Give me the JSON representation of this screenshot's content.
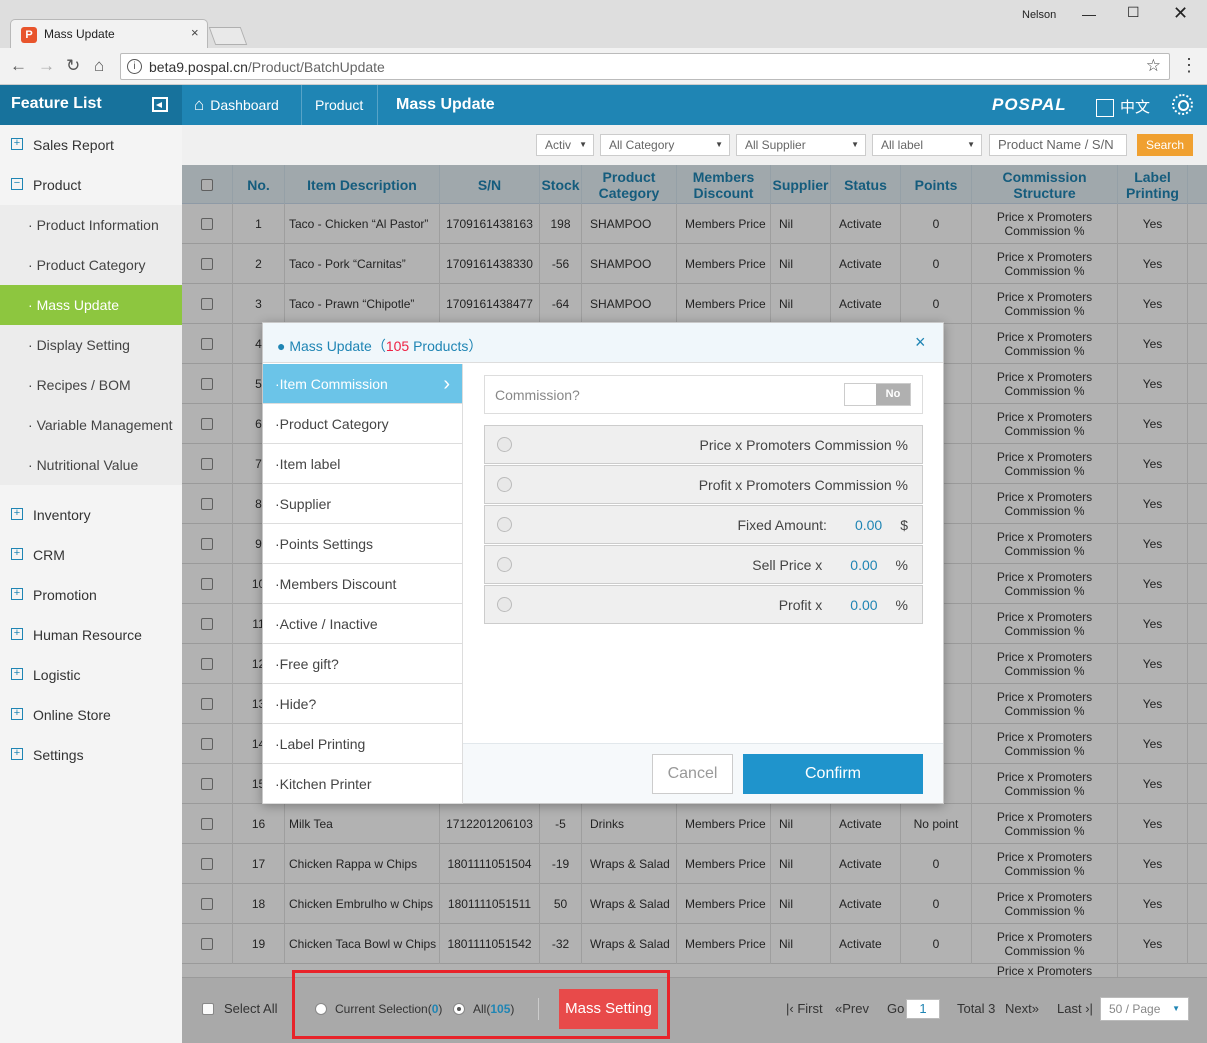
{
  "browser": {
    "tab_title": "Mass Update",
    "tab_close": "×",
    "user": "Nelson",
    "url_host": "beta9.pospal.cn",
    "url_path": "/Product/BatchUpdate"
  },
  "header": {
    "feature_list": "Feature List",
    "breadcrumb": [
      "Dashboard",
      "Product",
      "Mass Update"
    ],
    "logo": "POSPAL",
    "lang": "中文"
  },
  "sidebar": {
    "items": [
      {
        "label": "Sales Report",
        "sign": "+"
      },
      {
        "label": "Product",
        "sign": "−"
      }
    ],
    "subitems": [
      "Product Information",
      "Product Category",
      "Mass Update",
      "Display Setting",
      "Recipes / BOM",
      "Variable Management",
      "Nutritional Value"
    ],
    "active_sub": "Mass Update",
    "more_items": [
      "Inventory",
      "CRM",
      "Promotion",
      "Human Resource",
      "Logistic",
      "Online Store",
      "Settings"
    ]
  },
  "filters": {
    "status": "Activ",
    "category": "All Category",
    "supplier": "All Supplier",
    "label": "All label",
    "search_placeholder": "Product Name / S/N",
    "search_btn": "Search"
  },
  "table": {
    "headers": [
      "No.",
      "Item Description",
      "S/N",
      "Stock",
      "Product Category",
      "Members Discount",
      "Supplier",
      "Status",
      "Points",
      "Commission Structure",
      "Label Printing"
    ],
    "rows": [
      {
        "no": "1",
        "desc": "Taco - Chicken “Al Pastor”",
        "sn": "1709161438163",
        "stock": "198",
        "cat": "SHAMPOO",
        "disc": "Members Price",
        "sup": "Nil",
        "status": "Activate",
        "points": "0",
        "comm": "Price x Promoters Commission %",
        "label": "Yes"
      },
      {
        "no": "2",
        "desc": "Taco - Pork “Carnitas”",
        "sn": "1709161438330",
        "stock": "-56",
        "cat": "SHAMPOO",
        "disc": "Members Price",
        "sup": "Nil",
        "status": "Activate",
        "points": "0",
        "comm": "Price x Promoters Commission %",
        "label": "Yes"
      },
      {
        "no": "3",
        "desc": "Taco - Prawn “Chipotle”",
        "sn": "1709161438477",
        "stock": "-64",
        "cat": "SHAMPOO",
        "disc": "Members Price",
        "sup": "Nil",
        "status": "Activate",
        "points": "0",
        "comm": "Price x Promoters Commission %",
        "label": "Yes"
      },
      {
        "no": "4",
        "comm": "Price x Promoters Commission %",
        "label": "Yes"
      },
      {
        "no": "5",
        "comm": "Price x Promoters Commission %",
        "label": "Yes"
      },
      {
        "no": "6",
        "comm": "Price x Promoters Commission %",
        "label": "Yes"
      },
      {
        "no": "7",
        "comm": "Price x Promoters Commission %",
        "label": "Yes"
      },
      {
        "no": "8",
        "comm": "Price x Promoters Commission %",
        "label": "Yes"
      },
      {
        "no": "9",
        "comm": "Price x Promoters Commission %",
        "label": "Yes"
      },
      {
        "no": "10",
        "comm": "Price x Promoters Commission %",
        "label": "Yes"
      },
      {
        "no": "11",
        "comm": "Price x Promoters Commission %",
        "label": "Yes"
      },
      {
        "no": "12",
        "comm": "Price x Promoters Commission %",
        "label": "Yes"
      },
      {
        "no": "13",
        "comm": "Price x Promoters Commission %",
        "label": "Yes"
      },
      {
        "no": "14",
        "comm": "Price x Promoters Commission %",
        "label": "Yes"
      },
      {
        "no": "15",
        "comm": "Price x Promoters Commission %",
        "label": "Yes"
      },
      {
        "no": "16",
        "desc": "Milk Tea",
        "sn": "1712201206103",
        "stock": "-5",
        "cat": "Drinks",
        "disc": "Members Price",
        "sup": "Nil",
        "status": "Activate",
        "points": "No point",
        "comm": "Price x Promoters Commission %",
        "label": "Yes"
      },
      {
        "no": "17",
        "desc": "Chicken Rappa w Chips",
        "sn": "1801111051504",
        "stock": "-19",
        "cat": "Wraps & Salad",
        "disc": "Members Price",
        "sup": "Nil",
        "status": "Activate",
        "points": "0",
        "comm": "Price x Promoters Commission %",
        "label": "Yes"
      },
      {
        "no": "18",
        "desc": "Chicken Embrulho w Chips",
        "sn": "1801111051511",
        "stock": "50",
        "cat": "Wraps & Salad",
        "disc": "Members Price",
        "sup": "Nil",
        "status": "Activate",
        "points": "0",
        "comm": "Price x Promoters Commission %",
        "label": "Yes"
      },
      {
        "no": "19",
        "desc": "Chicken Taca Bowl w Chips",
        "sn": "1801111051542",
        "stock": "-32",
        "cat": "Wraps & Salad",
        "disc": "Members Price",
        "sup": "Nil",
        "status": "Activate",
        "points": "0",
        "comm": "Price x Promoters Commission %",
        "label": "Yes"
      }
    ],
    "partial_row": {
      "comm": "Price x Promoters"
    }
  },
  "modal": {
    "title": "Mass Update",
    "count_open": "（",
    "count": "105",
    "count_unit": "Products",
    "count_close": "）",
    "close": "×",
    "nav": [
      "Item Commission",
      "Product Category",
      "Item label",
      "Supplier",
      "Points Settings",
      "Members Discount",
      "Active / Inactive",
      "Free gift?",
      "Hide?",
      "Label Printing",
      "Kitchen Printer"
    ],
    "commission_label": "Commission?",
    "toggle": "No",
    "options": [
      {
        "text": "Price x Promoters Commission %"
      },
      {
        "text": "Profit x Promoters Commission %"
      },
      {
        "text": "Fixed Amount:",
        "value": "0.00",
        "unit": "$"
      },
      {
        "text": "Sell Price x",
        "value": "0.00",
        "unit": "%"
      },
      {
        "text": "Profit x",
        "value": "0.00",
        "unit": "%"
      }
    ],
    "cancel": "Cancel",
    "confirm": "Confirm"
  },
  "bottom": {
    "select_all": "Select All",
    "current_selection": "Current Selection(",
    "current_count": "0",
    "all": "All(",
    "all_count": "105",
    "close_paren": ")",
    "mass_setting": "Mass Setting",
    "first": "First",
    "prev": "Prev",
    "go": "Go",
    "page": "1",
    "total": "Total 3",
    "next": "Next",
    "last": "Last",
    "per_page": "50 / Page"
  },
  "colors": {
    "accent": "#1f85b4",
    "active_menu": "#8dc63f",
    "alert": "#e84a4a"
  }
}
